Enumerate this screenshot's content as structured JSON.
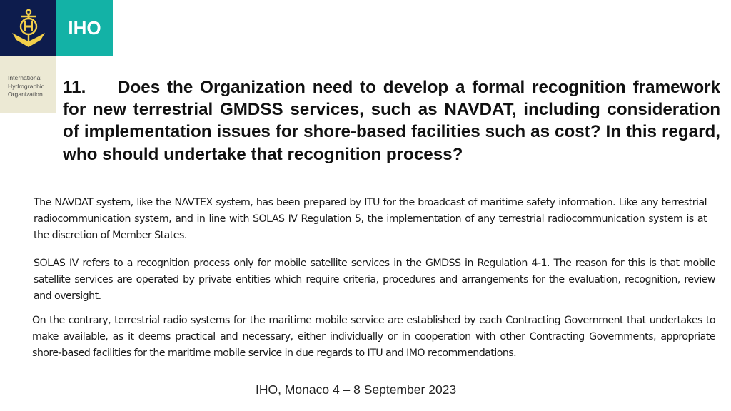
{
  "logo": {
    "acronym": "IHO",
    "org_name_lines": [
      "International",
      "Hydrographic",
      "Organization"
    ],
    "emblem_icon": "anchor-ih-emblem-icon",
    "colors": {
      "navy": "#0d1c4d",
      "teal": "#13b2a6",
      "beige": "#ece9d4",
      "gold": "#f2cf4a"
    }
  },
  "question": {
    "number": "11.",
    "text": "Does the Organization need to develop a formal recognition framework for new terrestrial GMDSS services, such as NAVDAT, including consideration of implementation issues for shore-based facilities such as cost? In this regard, who should undertake that recognition process?"
  },
  "paragraphs": [
    "The NAVDAT system, like the NAVTEX system, has been prepared by ITU for the broadcast of maritime safety information. Like any terrestrial radiocommunication system, and in line with SOLAS IV Regulation 5, the implementation of any terrestrial radiocommunication system is at the discretion of Member States.",
    "SOLAS IV refers to a recognition process only for mobile satellite services in the GMDSS in Regulation 4-1. The reason for this is that mobile satellite services are operated by private entities which require criteria, procedures and arrangements for the evaluation, recognition, review and oversight.",
    "On the contrary, terrestrial radio systems for the maritime mobile service are established by each Contracting Government that undertakes to make available, as it deems practical and necessary, either individually or in cooperation with other Contracting Governments, appropriate shore-based facilities for the maritime mobile service in due regards to ITU and IMO recommendations."
  ],
  "footer": "IHO, Monaco 4 – 8 September 2023"
}
